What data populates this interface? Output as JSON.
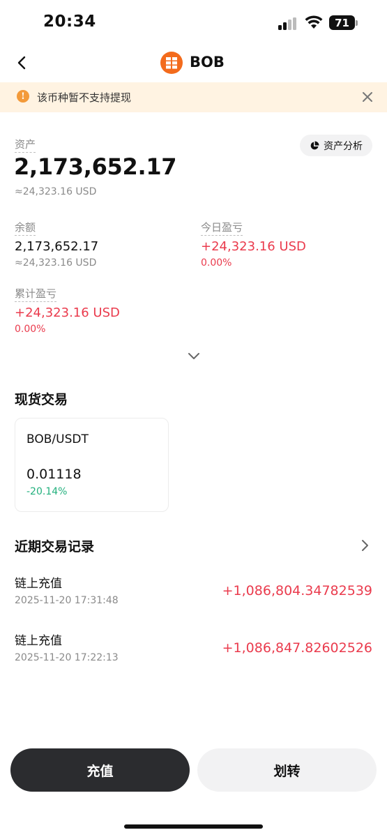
{
  "status_bar": {
    "time": "20:34",
    "battery": "71"
  },
  "header": {
    "coin": "BOB"
  },
  "notice": {
    "text": "该币种暂不支持提现"
  },
  "assets": {
    "label": "资产",
    "total": "2,173,652.17",
    "total_usd": "≈24,323.16 USD",
    "analysis_label": "资产分析"
  },
  "balance": {
    "label": "余额",
    "value": "2,173,652.17",
    "usd": "≈24,323.16 USD"
  },
  "today_pnl": {
    "label": "今日盈亏",
    "value": "+24,323.16 USD",
    "pct": "0.00%"
  },
  "total_pnl": {
    "label": "累计盈亏",
    "value": "+24,323.16 USD",
    "pct": "0.00%"
  },
  "spot": {
    "title": "现货交易",
    "pair": "BOB/USDT",
    "price": "0.01118",
    "change": "-20.14%"
  },
  "records": {
    "title": "近期交易记录",
    "items": [
      {
        "type": "链上充值",
        "time": "2025-11-20 17:31:48",
        "amount": "+1,086,804.34782539"
      },
      {
        "type": "链上充值",
        "time": "2025-11-20 17:22:13",
        "amount": "+1,086,847.82602526"
      }
    ]
  },
  "actions": {
    "deposit": "充值",
    "transfer": "划转"
  }
}
